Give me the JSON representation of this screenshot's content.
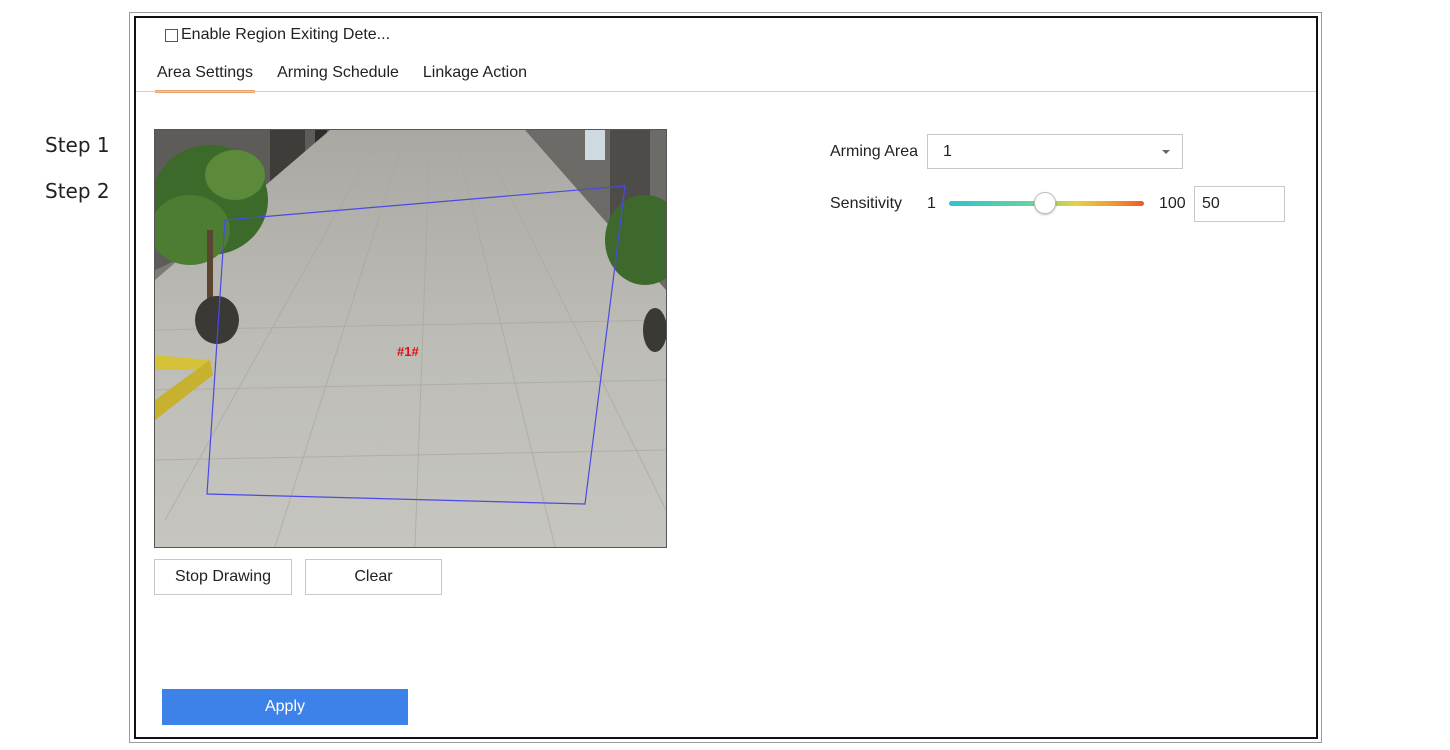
{
  "steps": [
    "Step 1",
    "Step 2"
  ],
  "enable_checkbox": {
    "label": "Enable Region Exiting Dete...",
    "checked": false
  },
  "tabs": [
    {
      "label": "Area Settings",
      "active": true
    },
    {
      "label": "Arming Schedule",
      "active": false
    },
    {
      "label": "Linkage Action",
      "active": false
    }
  ],
  "video": {
    "region_label": "#1#",
    "region_color": "#4a4ae6",
    "label_color": "#e01010"
  },
  "buttons": {
    "stop_drawing": "Stop Drawing",
    "clear": "Clear",
    "apply": "Apply"
  },
  "arming_area": {
    "label": "Arming Area",
    "value": "1"
  },
  "sensitivity": {
    "label": "Sensitivity",
    "min": "1",
    "max": "100",
    "value": "50"
  },
  "colors": {
    "accent": "#3d82e8",
    "tab_underline": "#e8a170"
  }
}
